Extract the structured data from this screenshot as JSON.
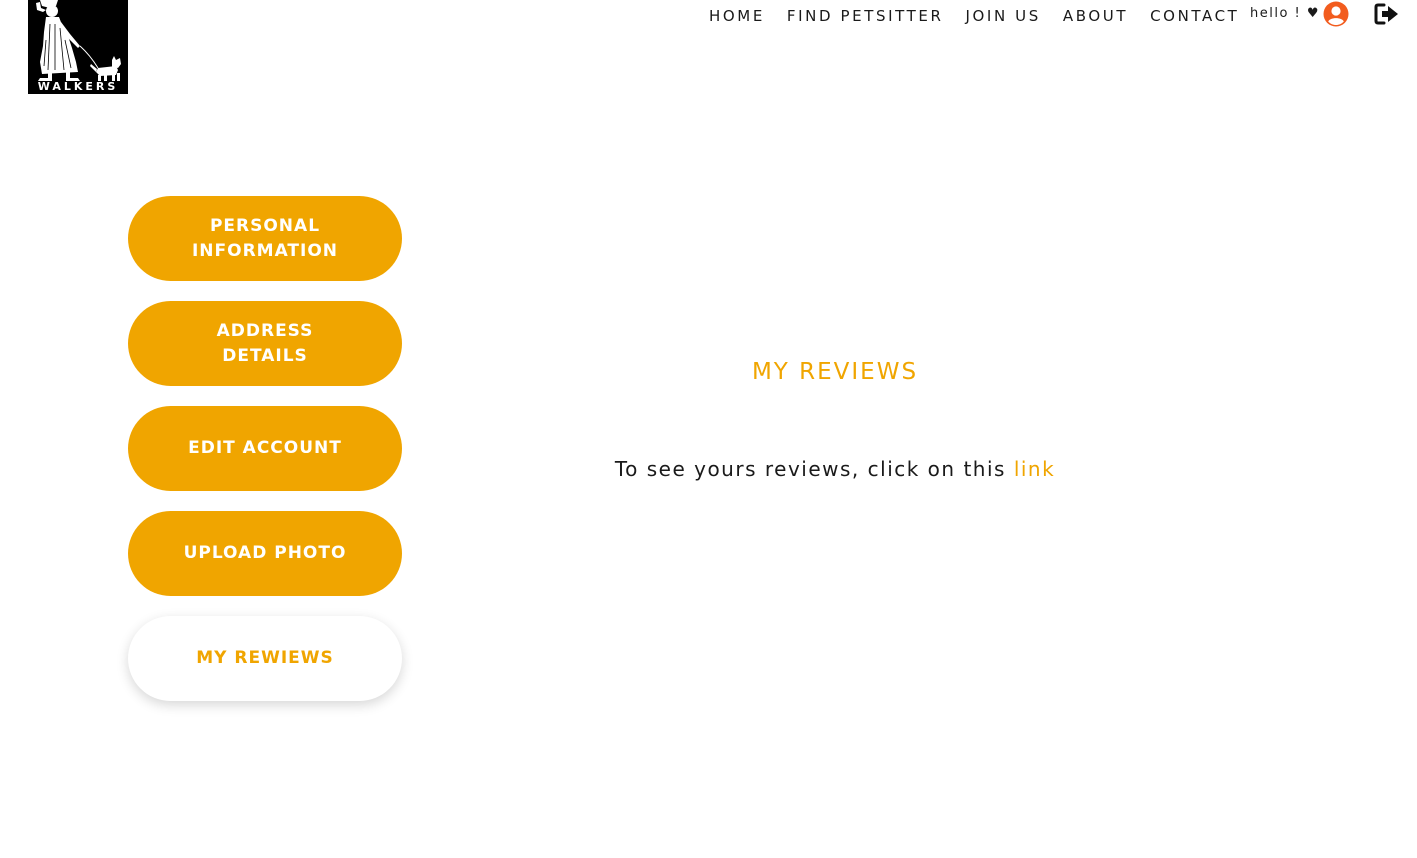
{
  "logo": {
    "text": "WALKERS"
  },
  "nav": {
    "items": [
      {
        "label": "HOME"
      },
      {
        "label": "FIND PETSITTER"
      },
      {
        "label": "JOIN US"
      },
      {
        "label": "ABOUT"
      },
      {
        "label": "CONTACT"
      }
    ],
    "greeting": "hello ! ♥",
    "user_icon": "user-circle-icon",
    "logout_icon": "sign-out-icon"
  },
  "sidebar": {
    "items": [
      {
        "label": "PERSONAL INFORMATION",
        "active": false
      },
      {
        "label": "ADDRESS DETAILS",
        "active": false
      },
      {
        "label": "EDIT ACCOUNT",
        "active": false
      },
      {
        "label": "UPLOAD PHOTO",
        "active": false
      },
      {
        "label": "MY REWIEWS",
        "active": true
      }
    ]
  },
  "main": {
    "title": "MY REVIEWS",
    "text": "To see yours reviews, click on this",
    "link_label": "link"
  },
  "colors": {
    "accent": "#f0a500",
    "user_icon": "#f25c1e",
    "text": "#1a1a1a",
    "background": "#ffffff"
  }
}
